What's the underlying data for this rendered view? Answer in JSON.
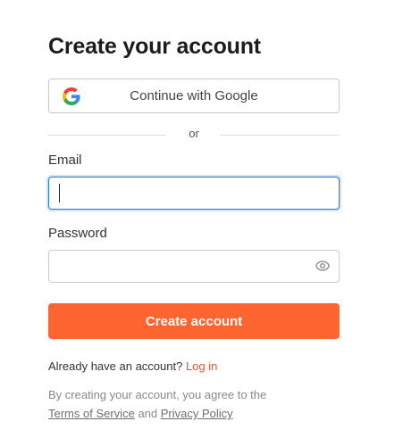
{
  "page": {
    "title": "Create your account"
  },
  "google_button": {
    "label": "Continue with Google",
    "icon": "google-logo-icon"
  },
  "divider": {
    "text": "or"
  },
  "email": {
    "label": "Email",
    "value": "",
    "placeholder": ""
  },
  "password": {
    "label": "Password",
    "value": "",
    "placeholder": "",
    "toggle_icon": "eye-icon"
  },
  "submit": {
    "label": "Create account"
  },
  "login_prompt": {
    "text": "Already have an account?",
    "link": "Log in"
  },
  "terms": {
    "prefix": "By creating your account, you agree to the",
    "tos_link": "Terms of Service",
    "conjunction": "and",
    "privacy_link": "Privacy Policy"
  },
  "colors": {
    "accent": "#ff6530",
    "link": "#e8552a",
    "focus_border": "#2b7bd3"
  }
}
